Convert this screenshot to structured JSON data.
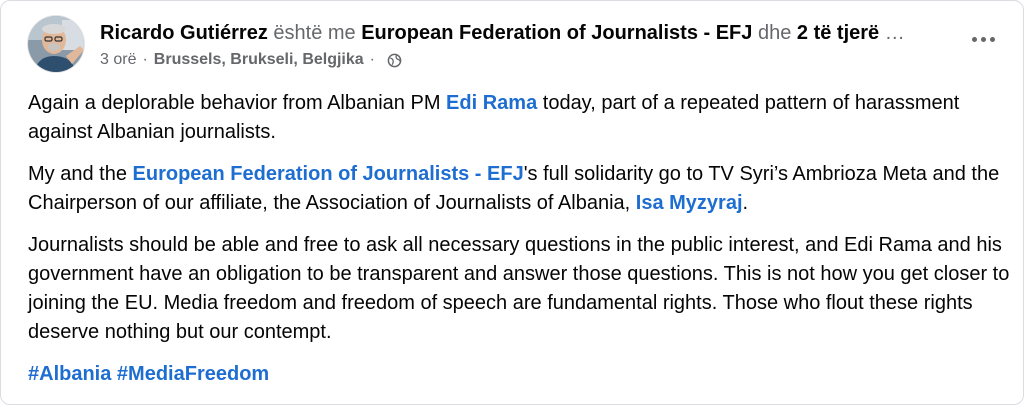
{
  "header": {
    "author": "Ricardo Gutiérrez",
    "with_text": "është me",
    "tagged": "European Federation of Journalists - EFJ",
    "and_text": "dhe",
    "others": "2 të tjerë",
    "ellipsis": "…",
    "time": "3 orë",
    "separator": "·",
    "location": "Brussels, Brukseli, Belgjika",
    "privacy_icon": "globe-icon",
    "more_icon": "more-dots-icon"
  },
  "body": {
    "p1": {
      "before": "Again a deplorable behavior from Albanian PM ",
      "link": "Edi Rama",
      "after": " today, part of a repeated pattern of harassment against Albanian journalists."
    },
    "p2": {
      "before": "My and the ",
      "link1": "European Federation of Journalists - EFJ",
      "middle": "'s full solidarity go to TV Syri’s Ambrioza Meta and the Chairperson of our affiliate, the Association of Journalists of Albania, ",
      "link2": "Isa Myzyraj",
      "after": "."
    },
    "p3": "Journalists should be able and free to ask all necessary questions in the public interest, and Edi Rama and his government have an obligation to be transparent and answer those questions. This is not how you get closer to joining the EU. Media freedom and freedom of speech are fundamental rights. Those who flout these rights deserve nothing but our contempt.",
    "hashtags": [
      "#Albania",
      "#MediaFreedom"
    ]
  },
  "colors": {
    "link": "#1e6ed2",
    "muted": "#65676b",
    "text": "#050505"
  }
}
